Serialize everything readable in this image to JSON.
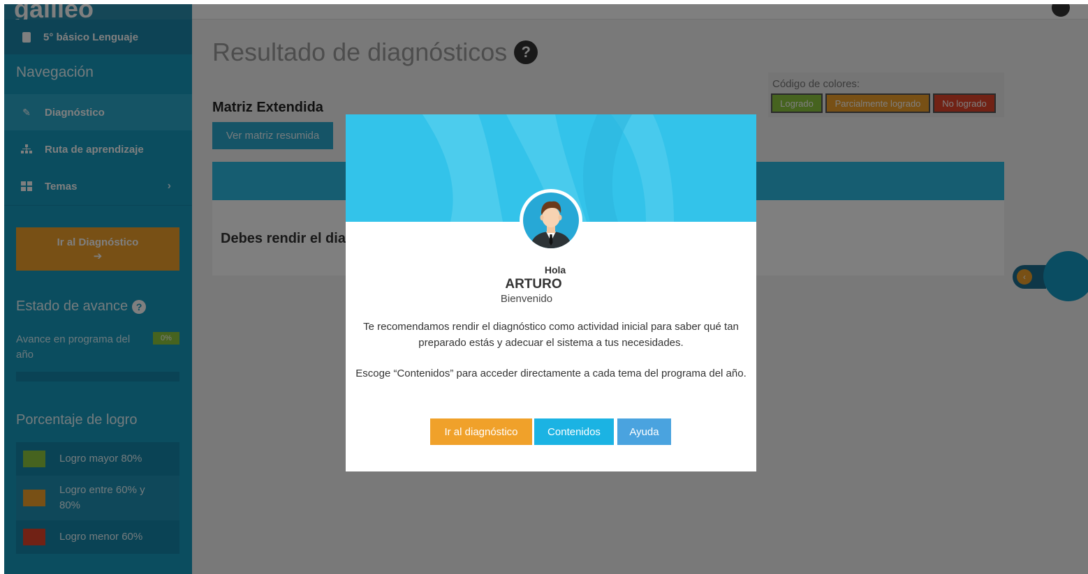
{
  "sidebar": {
    "logo": "galileo",
    "course": "5° básico Lenguaje",
    "nav_title": "Navegación",
    "items": [
      {
        "label": "Diagnóstico",
        "icon": "edit-icon"
      },
      {
        "label": "Ruta de aprendizaje",
        "icon": "sitemap-icon"
      },
      {
        "label": "Temas",
        "icon": "grid-icon"
      }
    ],
    "goto_diag": "Ir al Diagnóstico",
    "goto_diag_icon": "➔",
    "estado_title": "Estado de avance",
    "avance_label": "Avance en programa del año",
    "avance_value": "0%",
    "logro_title": "Porcentaje de logro",
    "legend": [
      {
        "label": "Logro mayor 80%",
        "color": "#8cc63f"
      },
      {
        "label": "Logro entre 60% y 80%",
        "color": "#f0a12a"
      },
      {
        "label": "Logro menor 60%",
        "color": "#e2452b"
      }
    ]
  },
  "main": {
    "title": "Resultado de diagnósticos",
    "colors_label": "Código de colores:",
    "chips": [
      {
        "label": "Logrado",
        "color": "#8cc63f"
      },
      {
        "label": "Parcialmente logrado",
        "color": "#f0a12a"
      },
      {
        "label": "No logrado",
        "color": "#e2452b"
      }
    ],
    "matriz_title": "Matriz Extendida",
    "ver_button": "Ver matriz resumida",
    "panel_text": "Debes rendir el dia"
  },
  "modal": {
    "hello": "Hola",
    "name": "ARTURO",
    "welcome": "Bienvenido",
    "paragraph1": "Te recomendamos rendir el diagnóstico como actividad inicial para saber qué tan preparado estás y adecuar el sistema a tus necesidades.",
    "paragraph2": "Escoge “Contenidos” para acceder directamente a cada tema del programa del año.",
    "buttons": {
      "diagnostico": "Ir al diagnóstico",
      "contenidos": "Contenidos",
      "ayuda": "Ayuda"
    }
  }
}
